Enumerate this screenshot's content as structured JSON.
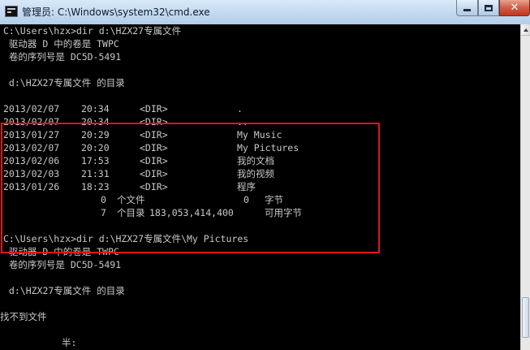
{
  "window": {
    "title": "管理员: C:\\Windows\\system32\\cmd.exe",
    "icon": "cmd-icon",
    "controls": {
      "minimize": "minimize-icon",
      "maximize": "maximize-icon",
      "close": "✕"
    }
  },
  "console": {
    "block1": {
      "prompt": "C:\\Users\\hzx>dir d:\\HZX27专属文件",
      "volume": " 驱动器 D 中的卷是 TWPC",
      "serial": " 卷的序列号是 DC5D-5491",
      "dirof": " d:\\HZX27专属文件 的目录"
    },
    "listing": [
      {
        "date": "2013/02/07",
        "time": "20:34",
        "type": "<DIR>",
        "name": "."
      },
      {
        "date": "2013/02/07",
        "time": "20:34",
        "type": "<DIR>",
        "name": ".."
      },
      {
        "date": "2013/01/27",
        "time": "20:29",
        "type": "<DIR>",
        "name": "My Music"
      },
      {
        "date": "2013/02/07",
        "time": "20:20",
        "type": "<DIR>",
        "name": "My Pictures"
      },
      {
        "date": "2013/02/06",
        "time": "17:53",
        "type": "<DIR>",
        "name": "我的文档"
      },
      {
        "date": "2013/02/03",
        "time": "21:31",
        "type": "<DIR>",
        "name": "我的视频"
      },
      {
        "date": "2013/01/26",
        "time": "18:23",
        "type": "<DIR>",
        "name": "程序"
      }
    ],
    "summary": {
      "files_count": "0",
      "files_label": "个文件",
      "files_bytes": "0",
      "files_unit": "字节",
      "dirs_count": "7",
      "dirs_label": "个目录",
      "dirs_bytes": "183,053,414,400",
      "dirs_unit": "可用字节"
    },
    "block2": {
      "prompt": "C:\\Users\\hzx>dir d:\\HZX27专属文件\\My Pictures",
      "volume": " 驱动器 D 中的卷是 TWPC",
      "serial": " 卷的序列号是 DC5D-5491",
      "dirof": " d:\\HZX27专属文件 的目录",
      "notfound": "找不到文件",
      "ime": "半:"
    },
    "highlight_color": "#e0141c",
    "text_color": "#c8c8c8",
    "background_color": "#000000"
  }
}
